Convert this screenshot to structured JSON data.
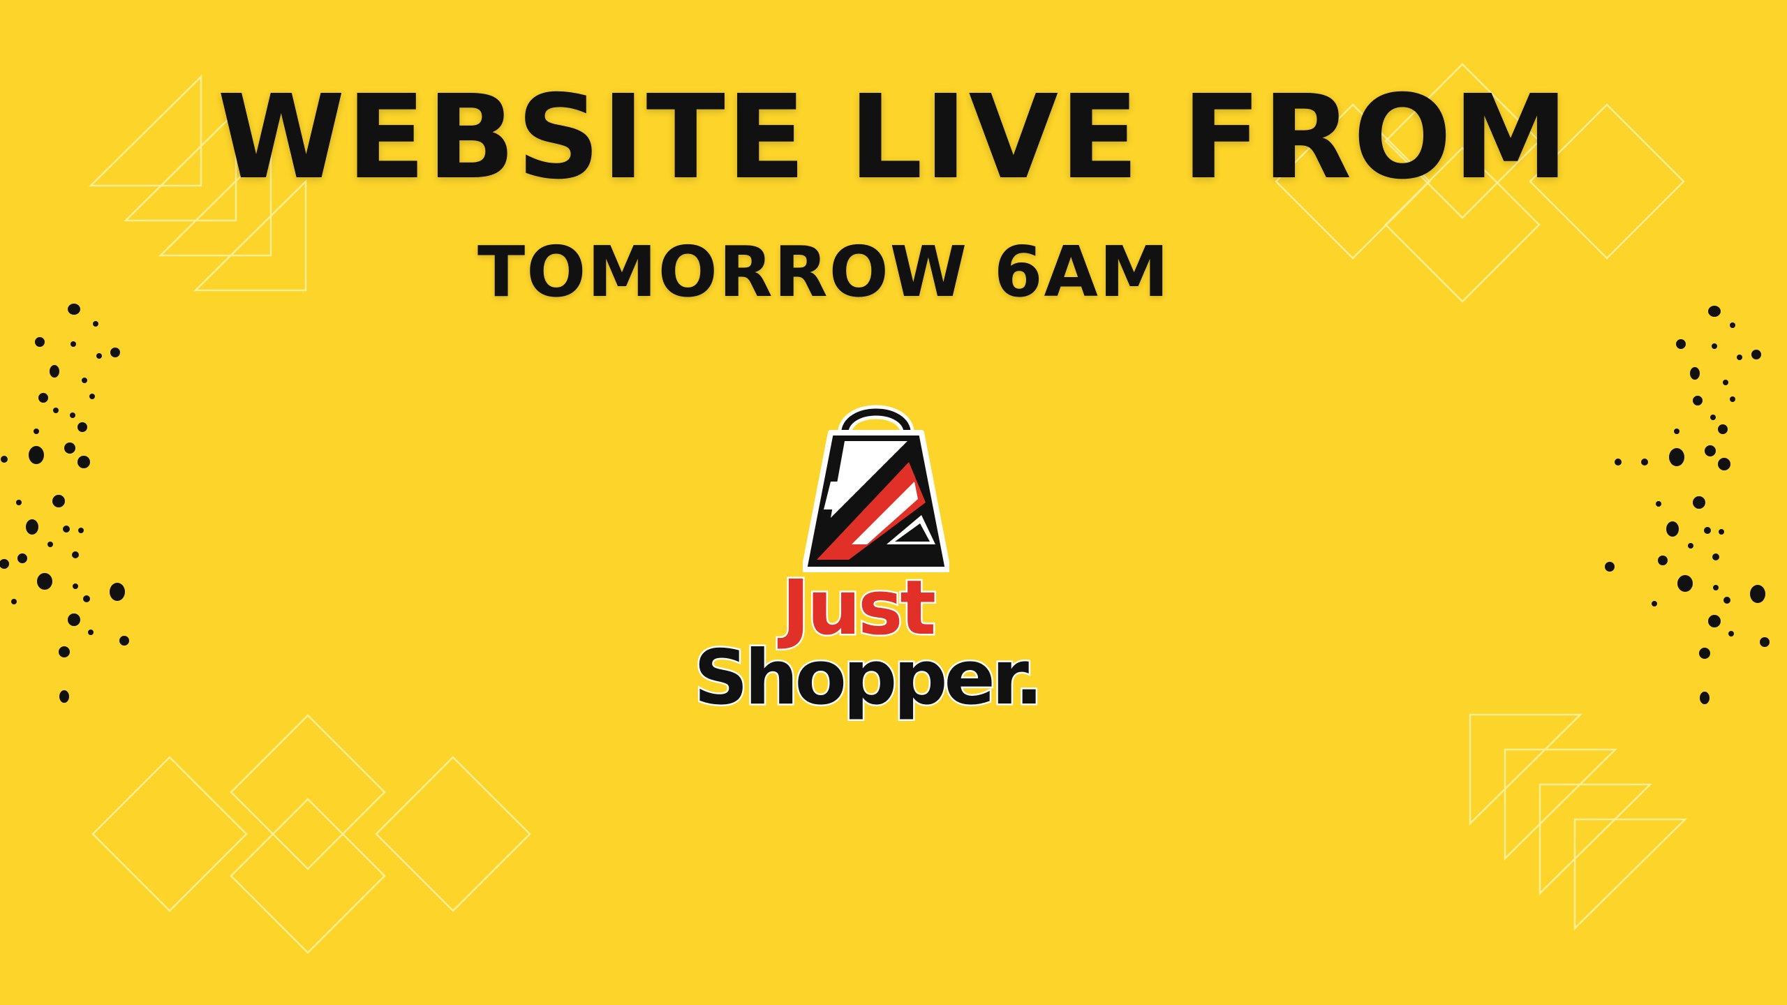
{
  "headline": "WEBSITE LIVE FROM",
  "subheadline": "TOMORROW 6AM",
  "brand": {
    "line1": "Just",
    "line2": "Shopper.",
    "logo_icon": "shopping-bag-icon"
  },
  "colors": {
    "background": "#FCD42A",
    "text": "#111111",
    "brand_red": "#E13028",
    "outline": "#FFF3A8"
  }
}
